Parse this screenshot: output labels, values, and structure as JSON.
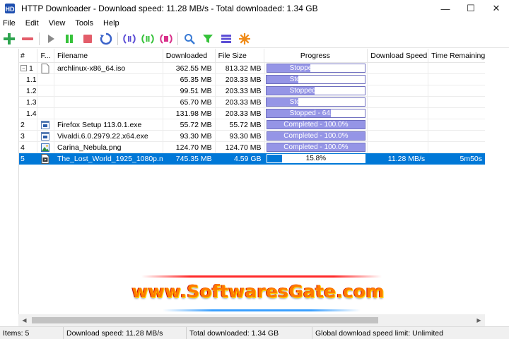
{
  "window": {
    "title": "HTTP Downloader - Download speed: 11.28 MB/s - Total downloaded: 1.34 GB",
    "minimize": "—",
    "maximize": "☐",
    "close": "✕"
  },
  "menu": [
    "File",
    "Edit",
    "View",
    "Tools",
    "Help"
  ],
  "toolbar": [
    {
      "name": "add-icon",
      "color": "#2ea44f"
    },
    {
      "name": "remove-icon",
      "color": "#e35d6a"
    },
    {
      "name": "play-icon",
      "color": "#8a8a8a"
    },
    {
      "name": "pause-icon",
      "color": "#36c23a"
    },
    {
      "name": "stop-icon",
      "color": "#e35d6a"
    },
    {
      "name": "restart-icon",
      "color": "#3a62c9"
    },
    {
      "name": "pause-active-icon",
      "color": "#5d4fd6"
    },
    {
      "name": "pause-all-icon",
      "color": "#36c23a"
    },
    {
      "name": "stop-all-icon",
      "color": "#d8308a"
    },
    {
      "name": "search-icon",
      "color": "#3a7bd5"
    },
    {
      "name": "filter-icon",
      "color": "#36c23a"
    },
    {
      "name": "queue-icon",
      "color": "#5d4fd6"
    },
    {
      "name": "options-icon",
      "color": "#f08c1a"
    }
  ],
  "columns": {
    "num": "#",
    "filetype": "F...",
    "filename": "Filename",
    "downloaded": "Downloaded",
    "filesize": "File Size",
    "progress": "Progress",
    "speed": "Download Speed",
    "remaining": "Time Remaining"
  },
  "rows": [
    {
      "num": "1",
      "expander": "−",
      "icon": "file-icon",
      "filename": "archlinux-x86_64.iso",
      "downloaded": "362.55 MB",
      "filesize": "813.32 MB",
      "progress_text": "Stopped - 44.5%",
      "progress": 0.445,
      "speed": "",
      "remaining": "",
      "selected": false
    },
    {
      "num": "1.1",
      "icon": "",
      "filename": "",
      "downloaded": "65.35 MB",
      "filesize": "203.33 MB",
      "progress_text": "Stopped - 32.1%",
      "progress": 0.321,
      "speed": "",
      "remaining": "",
      "selected": false
    },
    {
      "num": "1.2",
      "icon": "",
      "filename": "",
      "downloaded": "99.51 MB",
      "filesize": "203.33 MB",
      "progress_text": "Stopped - 48.9%",
      "progress": 0.489,
      "speed": "",
      "remaining": "",
      "selected": false
    },
    {
      "num": "1.3",
      "icon": "",
      "filename": "",
      "downloaded": "65.70 MB",
      "filesize": "203.33 MB",
      "progress_text": "Stopped - 32.3%",
      "progress": 0.323,
      "speed": "",
      "remaining": "",
      "selected": false
    },
    {
      "num": "1.4",
      "icon": "",
      "filename": "",
      "downloaded": "131.98 MB",
      "filesize": "203.33 MB",
      "progress_text": "Stopped - 64.9%",
      "progress": 0.649,
      "speed": "",
      "remaining": "",
      "selected": false
    },
    {
      "num": "2",
      "icon": "app-icon",
      "filename": "Firefox Setup 113.0.1.exe",
      "downloaded": "55.72 MB",
      "filesize": "55.72 MB",
      "progress_text": "Completed - 100.0%",
      "progress": 1.0,
      "speed": "",
      "remaining": "",
      "selected": false
    },
    {
      "num": "3",
      "icon": "app-icon",
      "filename": "Vivaldi.6.0.2979.22.x64.exe",
      "downloaded": "93.30 MB",
      "filesize": "93.30 MB",
      "progress_text": "Completed - 100.0%",
      "progress": 1.0,
      "speed": "",
      "remaining": "",
      "selected": false
    },
    {
      "num": "4",
      "icon": "image-icon",
      "filename": "Carina_Nebula.png",
      "downloaded": "124.70 MB",
      "filesize": "124.70 MB",
      "progress_text": "Completed - 100.0%",
      "progress": 1.0,
      "speed": "",
      "remaining": "",
      "selected": false
    },
    {
      "num": "5",
      "icon": "video-icon",
      "filename": "The_Lost_World_1925_1080p.mkv",
      "downloaded": "745.35 MB",
      "filesize": "4.59 GB",
      "progress_text": "15.8%",
      "progress": 0.158,
      "speed": "11.28 MB/s",
      "remaining": "5m50s",
      "selected": true
    }
  ],
  "status": {
    "items": "Items: 5",
    "speed": "Download speed: 11.28 MB/s",
    "total": "Total downloaded: 1.34 GB",
    "limit": "Global download speed limit: Unlimited"
  },
  "watermark": "www.SoftwaresGate.com",
  "colors": {
    "selection": "#0078d7",
    "progress_fill": "#9595e6",
    "progress_border": "#6f6fbf"
  }
}
